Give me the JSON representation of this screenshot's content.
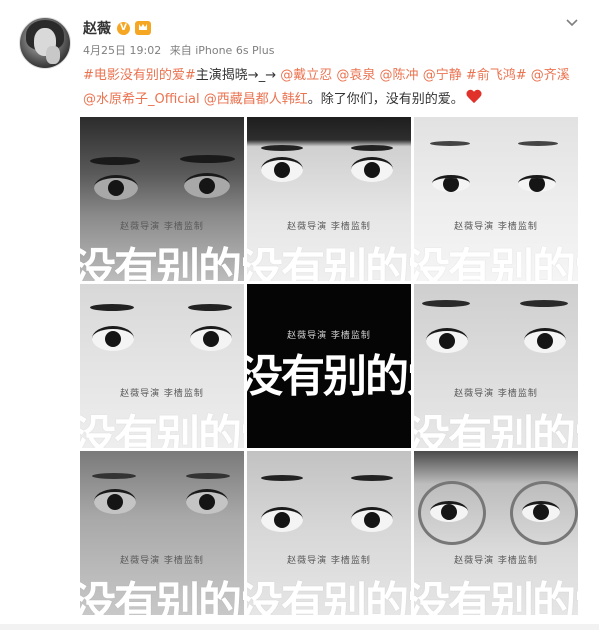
{
  "post": {
    "author": "赵薇",
    "verified_badge": "V",
    "meta": {
      "date": "4月25日 19:02",
      "source": "来自 iPhone 6s Plus"
    },
    "text": {
      "line1_hashtag1": "#电影没有别的爱#",
      "line1_text": "主演揭晓→_→",
      "mentions": [
        "@戴立忍",
        "@袁泉",
        "@陈冲",
        "@宁静"
      ],
      "hashtag2": "#俞飞鸿#",
      "mention_qi": "@齐溪",
      "mentions2": [
        "@水原希子_Official",
        "@西藏昌都人韩红"
      ],
      "closing": "。除了你们，没有别的爱。",
      "emoji": "heart"
    },
    "poster_credit": "赵薇导演 李樯监制",
    "poster_title": "没有别的爱"
  },
  "colors": {
    "link": "#eb7350",
    "badge": "#f5a623",
    "heart": "#e0312a"
  }
}
